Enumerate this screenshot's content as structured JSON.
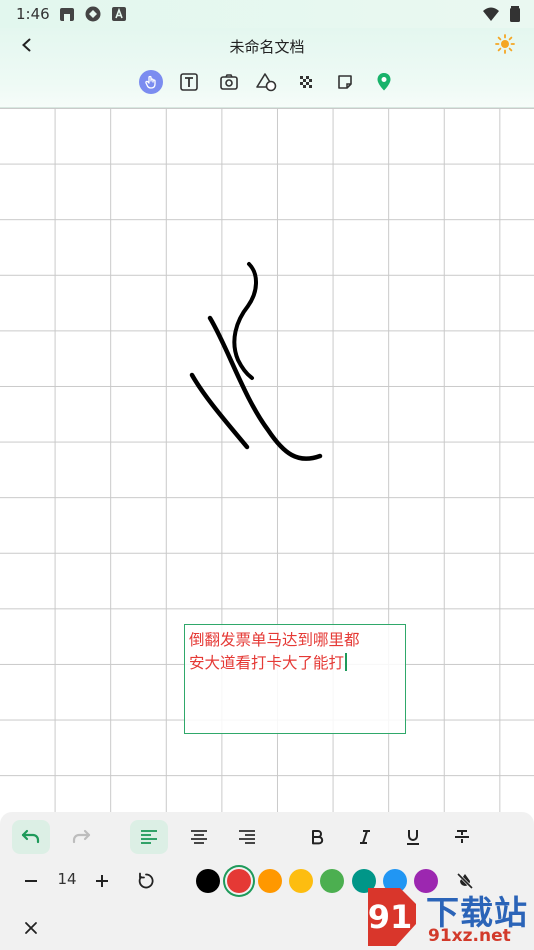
{
  "status_bar": {
    "time": "1:46"
  },
  "header": {
    "title": "未命名文档"
  },
  "toolbar": {
    "tools": [
      {
        "icon": "hand-pointer-icon",
        "active": true
      },
      {
        "icon": "text-box-icon"
      },
      {
        "icon": "camera-icon"
      },
      {
        "icon": "shapes-icon"
      },
      {
        "icon": "mosaic-icon"
      },
      {
        "icon": "sticky-note-icon"
      },
      {
        "icon": "location-pin-icon"
      }
    ]
  },
  "canvas": {
    "text_box": {
      "line1": "倒翻发票单马达到哪里都",
      "line2": "安大道看打卡大了能打"
    }
  },
  "bottom_panel": {
    "font_size": "14",
    "colors": [
      "#000000",
      "#e53935",
      "#ff9800",
      "#fdbd10",
      "#4caf50",
      "#009688",
      "#2196f3",
      "#9c27b0"
    ],
    "selected_color": "#e53935"
  },
  "watermark": {
    "cn": "下载站",
    "url": "91xz.net"
  }
}
